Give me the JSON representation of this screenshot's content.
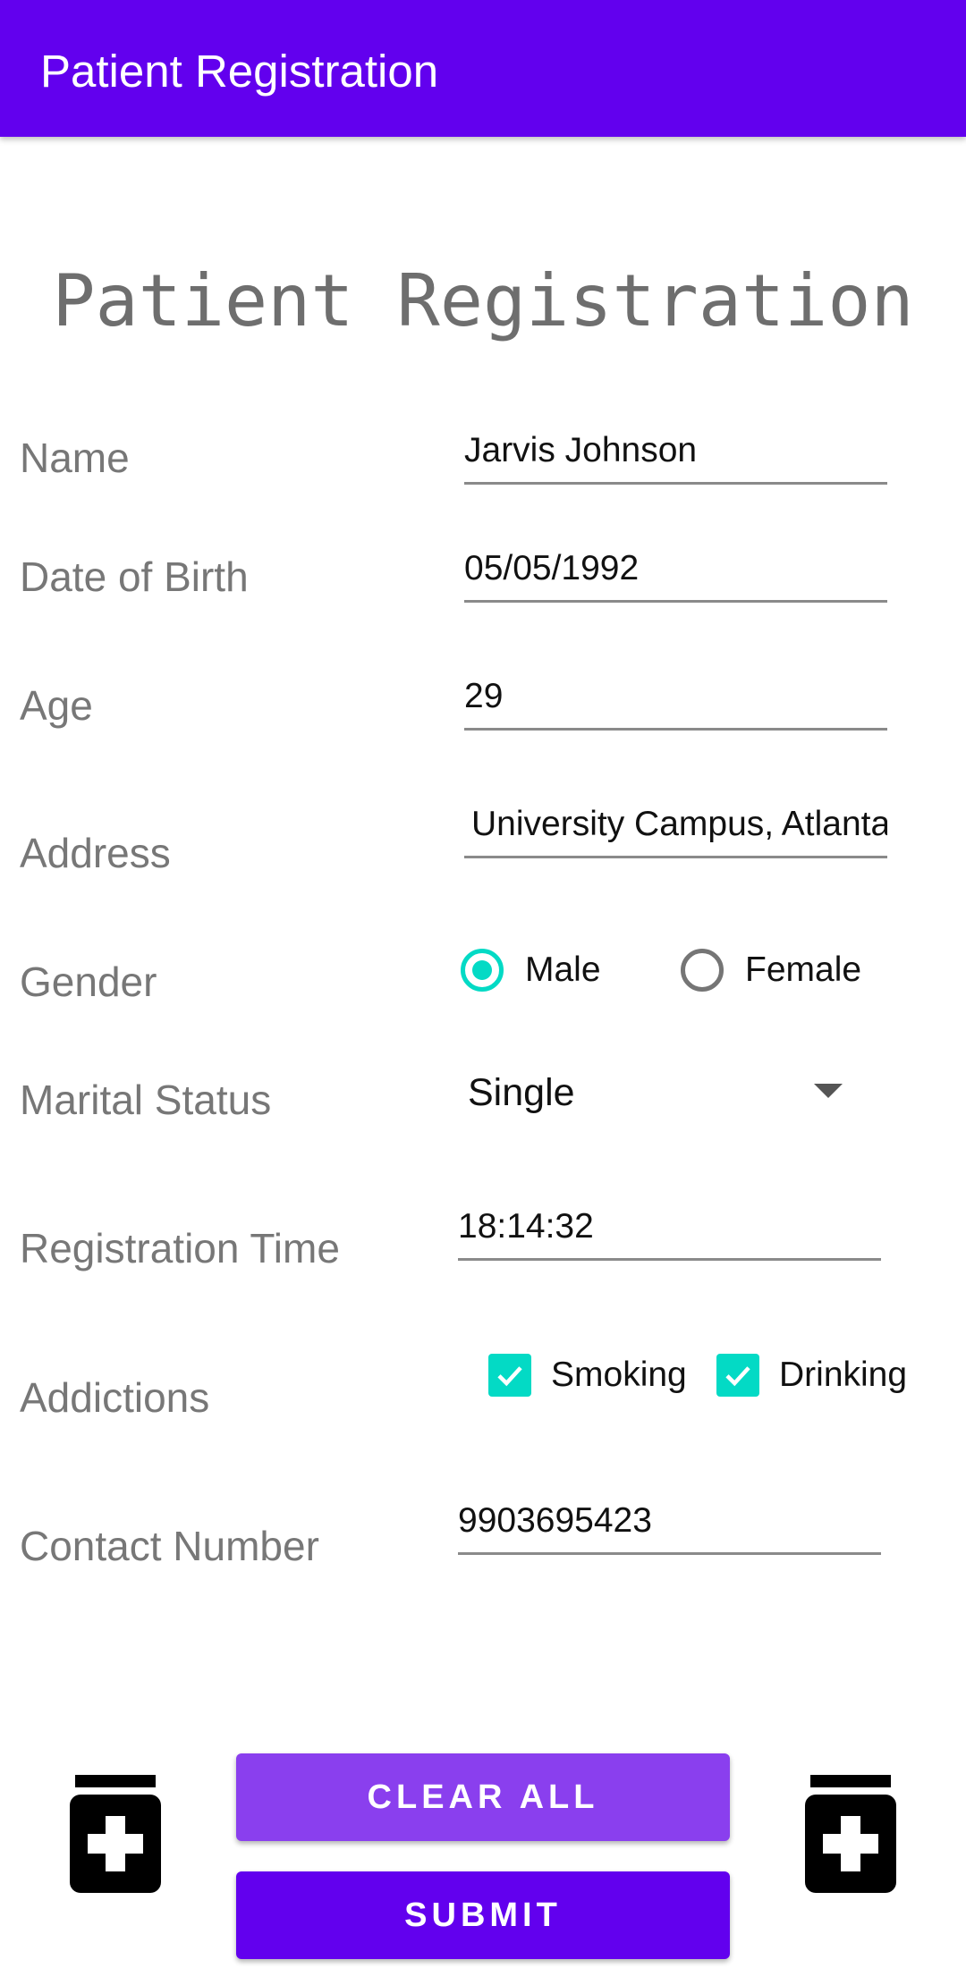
{
  "appbar": {
    "title": "Patient Registration"
  },
  "form": {
    "heading": "Patient Registration",
    "name": {
      "label": "Name",
      "value": "Jarvis Johnson"
    },
    "dob": {
      "label": "Date of Birth",
      "value": "05/05/1992"
    },
    "age": {
      "label": "Age",
      "value": "29"
    },
    "address": {
      "label": "Address",
      "value": "University Campus, Atlanta"
    },
    "gender": {
      "label": "Gender",
      "options": [
        {
          "label": "Male",
          "selected": true
        },
        {
          "label": "Female",
          "selected": false
        }
      ]
    },
    "marital": {
      "label": "Marital Status",
      "selected": "Single"
    },
    "registration_time": {
      "label": "Registration Time",
      "value": "18:14:32"
    },
    "addictions": {
      "label": "Addictions",
      "options": [
        {
          "label": "Smoking",
          "checked": true
        },
        {
          "label": "Drinking",
          "checked": true
        }
      ]
    },
    "contact": {
      "label": "Contact Number",
      "value": "9903695423"
    }
  },
  "buttons": {
    "clear": "Clear all",
    "submit": "Submit"
  },
  "colors": {
    "primary": "#6200EE",
    "primary_light": "#8A3FEE",
    "accent": "#03DAC5"
  },
  "icons": {
    "left": "medicine-jar-icon",
    "right": "medicine-jar-icon"
  }
}
